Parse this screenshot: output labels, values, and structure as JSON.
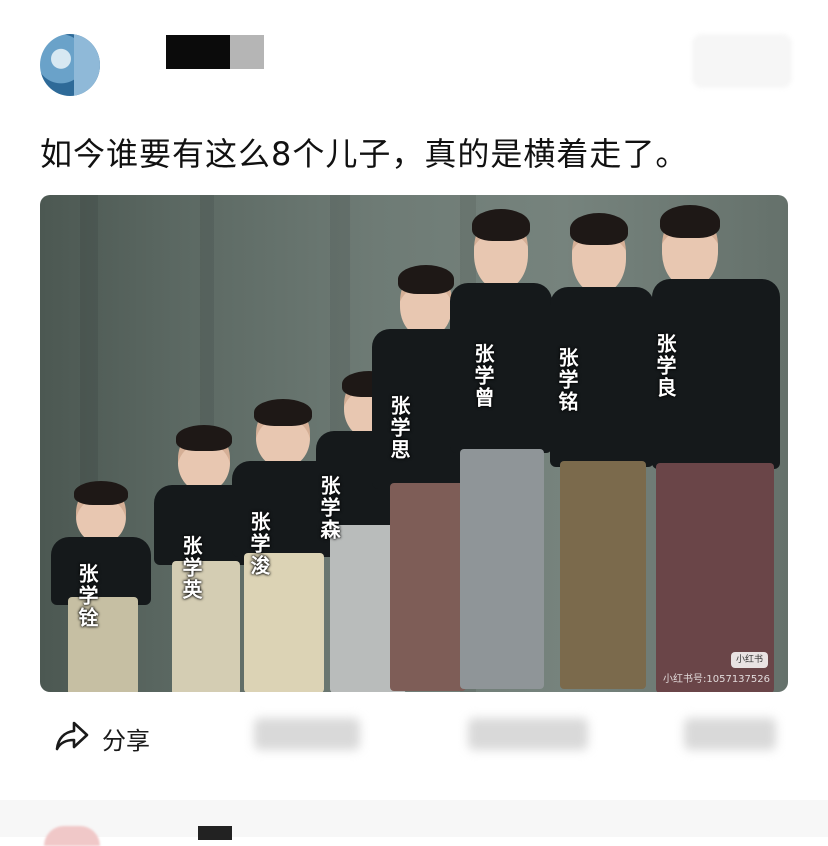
{
  "post": {
    "text": "如今谁要有这么8个儿子，真的是横着走了。"
  },
  "photo": {
    "labels": [
      "张学铨",
      "张学英",
      "张学浚",
      "张学森",
      "张学思",
      "张学曾",
      "张学铭",
      "张学良"
    ],
    "watermark_badge": "小红书",
    "watermark_text": "小红书号:1057137526"
  },
  "actions": {
    "share_label": "分享"
  },
  "colors": {
    "background": "#ffffff",
    "text": "#111111",
    "photo_backdrop": "#6e7b75"
  },
  "icons": {
    "share": "share-arrow-icon"
  }
}
